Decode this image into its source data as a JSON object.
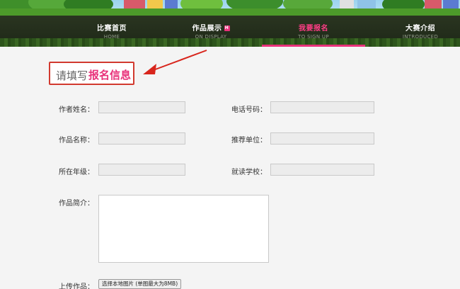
{
  "nav": {
    "items": [
      {
        "zh": "比赛首页",
        "en": "HOME"
      },
      {
        "zh": "作品展示",
        "en": "ON DISPLAY",
        "badge": "H"
      },
      {
        "zh": "我要报名",
        "en": "TO SIGN UP"
      },
      {
        "zh": "大赛介绍",
        "en": "INTRODUCED"
      }
    ],
    "active_index": 2,
    "accent": "#e8317a"
  },
  "form": {
    "title_plain": "请填写",
    "title_highlight": "报名信息",
    "labels": {
      "author_name": "作者姓名：",
      "phone": "电话号码：",
      "work_name": "作品名称：",
      "recommend_unit": "推荐单位：",
      "grade": "所在年级：",
      "school": "就读学校：",
      "intro": "作品简介：",
      "upload": "上传作品："
    },
    "upload_button": "选择本地图片 (单图最大为8MB)"
  }
}
